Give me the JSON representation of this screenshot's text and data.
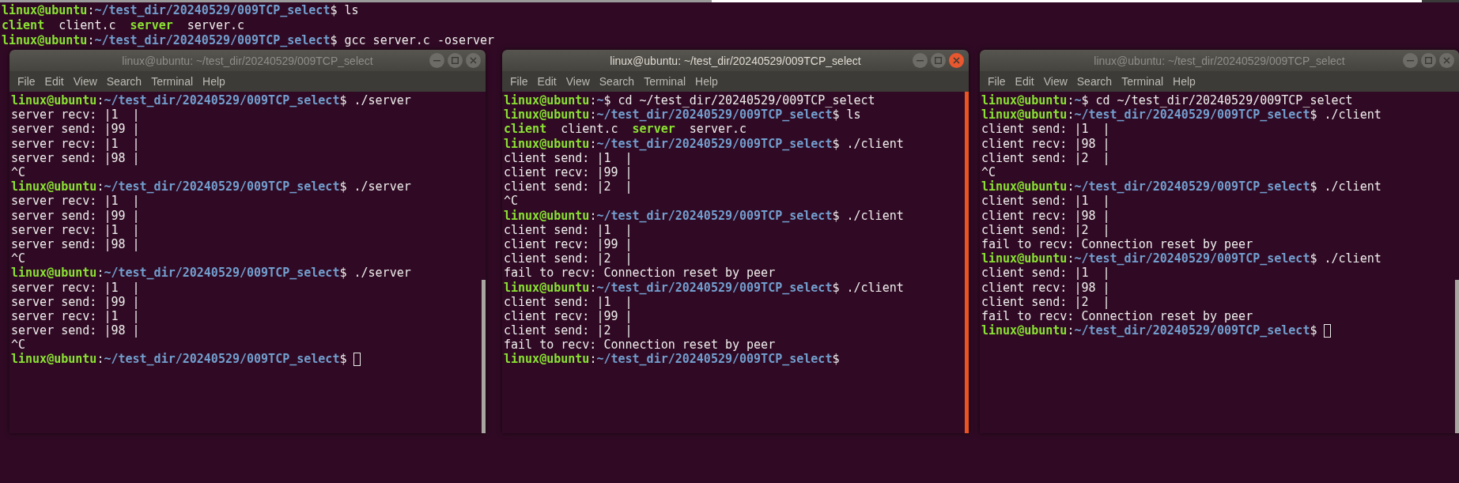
{
  "background_terminal": {
    "lines": [
      {
        "kind": "prompt",
        "user": "linux@ubuntu",
        "separator": ":",
        "path": "~/test_dir/20240529/009TCP_select",
        "symbol": "$",
        "command": "ls"
      },
      {
        "kind": "listing",
        "items": [
          {
            "name": "client",
            "executable": true
          },
          {
            "name": "client.c",
            "executable": false
          },
          {
            "name": "server",
            "executable": true
          },
          {
            "name": "server.c",
            "executable": false
          }
        ]
      },
      {
        "kind": "prompt",
        "user": "linux@ubuntu",
        "separator": ":",
        "path": "~/test_dir/20240529/009TCP_select",
        "symbol": "$",
        "command": "gcc server.c -oserver"
      }
    ]
  },
  "windows": [
    {
      "title": "linux@ubuntu: ~/test_dir/20240529/009TCP_select",
      "active": false,
      "menu": [
        "File",
        "Edit",
        "View",
        "Search",
        "Terminal",
        "Help"
      ],
      "lines": [
        {
          "kind": "prompt",
          "user": "linux@ubuntu",
          "separator": ":",
          "path": "~/test_dir/20240529/009TCP_select",
          "symbol": "$",
          "command": "./server"
        },
        {
          "kind": "output",
          "text": "server recv: |1  |"
        },
        {
          "kind": "output",
          "text": "server send: |99 |"
        },
        {
          "kind": "output",
          "text": "server recv: |1  |"
        },
        {
          "kind": "output",
          "text": "server send: |98 |"
        },
        {
          "kind": "output",
          "text": "^C"
        },
        {
          "kind": "prompt",
          "user": "linux@ubuntu",
          "separator": ":",
          "path": "~/test_dir/20240529/009TCP_select",
          "symbol": "$",
          "command": "./server"
        },
        {
          "kind": "output",
          "text": "server recv: |1  |"
        },
        {
          "kind": "output",
          "text": "server send: |99 |"
        },
        {
          "kind": "output",
          "text": "server recv: |1  |"
        },
        {
          "kind": "output",
          "text": "server send: |98 |"
        },
        {
          "kind": "output",
          "text": "^C"
        },
        {
          "kind": "prompt",
          "user": "linux@ubuntu",
          "separator": ":",
          "path": "~/test_dir/20240529/009TCP_select",
          "symbol": "$",
          "command": "./server"
        },
        {
          "kind": "output",
          "text": "server recv: |1  |"
        },
        {
          "kind": "output",
          "text": "server send: |99 |"
        },
        {
          "kind": "output",
          "text": "server recv: |1  |"
        },
        {
          "kind": "output",
          "text": "server send: |98 |"
        },
        {
          "kind": "output",
          "text": "^C"
        },
        {
          "kind": "prompt",
          "user": "linux@ubuntu",
          "separator": ":",
          "path": "~/test_dir/20240529/009TCP_select",
          "symbol": "$",
          "cursor": true
        }
      ]
    },
    {
      "title": "linux@ubuntu: ~/test_dir/20240529/009TCP_select",
      "active": true,
      "menu": [
        "File",
        "Edit",
        "View",
        "Search",
        "Terminal",
        "Help"
      ],
      "lines": [
        {
          "kind": "prompt",
          "user": "linux@ubuntu",
          "separator": ":",
          "path": "~",
          "symbol": "$",
          "command": "cd ~/test_dir/20240529/009TCP_select"
        },
        {
          "kind": "prompt",
          "user": "linux@ubuntu",
          "separator": ":",
          "path": "~/test_dir/20240529/009TCP_select",
          "symbol": "$",
          "command": "ls"
        },
        {
          "kind": "listing",
          "items": [
            {
              "name": "client",
              "executable": true
            },
            {
              "name": "client.c",
              "executable": false
            },
            {
              "name": "server",
              "executable": true
            },
            {
              "name": "server.c",
              "executable": false
            }
          ]
        },
        {
          "kind": "prompt",
          "user": "linux@ubuntu",
          "separator": ":",
          "path": "~/test_dir/20240529/009TCP_select",
          "symbol": "$",
          "command": "./client"
        },
        {
          "kind": "output",
          "text": "client send: |1  |"
        },
        {
          "kind": "output",
          "text": "client recv: |99 |"
        },
        {
          "kind": "output",
          "text": "client send: |2  |"
        },
        {
          "kind": "output",
          "text": "^C"
        },
        {
          "kind": "prompt",
          "user": "linux@ubuntu",
          "separator": ":",
          "path": "~/test_dir/20240529/009TCP_select",
          "symbol": "$",
          "command": "./client"
        },
        {
          "kind": "output",
          "text": "client send: |1  |"
        },
        {
          "kind": "output",
          "text": "client recv: |99 |"
        },
        {
          "kind": "output",
          "text": "client send: |2  |"
        },
        {
          "kind": "output",
          "text": "fail to recv: Connection reset by peer"
        },
        {
          "kind": "prompt",
          "user": "linux@ubuntu",
          "separator": ":",
          "path": "~/test_dir/20240529/009TCP_select",
          "symbol": "$",
          "command": "./client"
        },
        {
          "kind": "output",
          "text": "client send: |1  |"
        },
        {
          "kind": "output",
          "text": "client recv: |99 |"
        },
        {
          "kind": "output",
          "text": "client send: |2  |"
        },
        {
          "kind": "output",
          "text": "fail to recv: Connection reset by peer"
        },
        {
          "kind": "prompt",
          "user": "linux@ubuntu",
          "separator": ":",
          "path": "~/test_dir/20240529/009TCP_select",
          "symbol": "$"
        }
      ]
    },
    {
      "title": "linux@ubuntu: ~/test_dir/20240529/009TCP_select",
      "active": false,
      "menu": [
        "File",
        "Edit",
        "View",
        "Search",
        "Terminal",
        "Help"
      ],
      "lines": [
        {
          "kind": "prompt",
          "user": "linux@ubuntu",
          "separator": ":",
          "path": "~",
          "symbol": "$",
          "command": "cd ~/test_dir/20240529/009TCP_select"
        },
        {
          "kind": "prompt",
          "user": "linux@ubuntu",
          "separator": ":",
          "path": "~/test_dir/20240529/009TCP_select",
          "symbol": "$",
          "command": "./client"
        },
        {
          "kind": "output",
          "text": "client send: |1  |"
        },
        {
          "kind": "output",
          "text": "client recv: |98 |"
        },
        {
          "kind": "output",
          "text": "client send: |2  |"
        },
        {
          "kind": "output",
          "text": "^C"
        },
        {
          "kind": "prompt",
          "user": "linux@ubuntu",
          "separator": ":",
          "path": "~/test_dir/20240529/009TCP_select",
          "symbol": "$",
          "command": "./client"
        },
        {
          "kind": "output",
          "text": "client send: |1  |"
        },
        {
          "kind": "output",
          "text": "client recv: |98 |"
        },
        {
          "kind": "output",
          "text": "client send: |2  |"
        },
        {
          "kind": "output",
          "text": "fail to recv: Connection reset by peer"
        },
        {
          "kind": "prompt",
          "user": "linux@ubuntu",
          "separator": ":",
          "path": "~/test_dir/20240529/009TCP_select",
          "symbol": "$",
          "command": "./client"
        },
        {
          "kind": "output",
          "text": "client send: |1  |"
        },
        {
          "kind": "output",
          "text": "client recv: |98 |"
        },
        {
          "kind": "output",
          "text": "client send: |2  |"
        },
        {
          "kind": "output",
          "text": "fail to recv: Connection reset by peer"
        },
        {
          "kind": "prompt",
          "user": "linux@ubuntu",
          "separator": ":",
          "path": "~/test_dir/20240529/009TCP_select",
          "symbol": "$",
          "cursor": true
        }
      ]
    }
  ]
}
